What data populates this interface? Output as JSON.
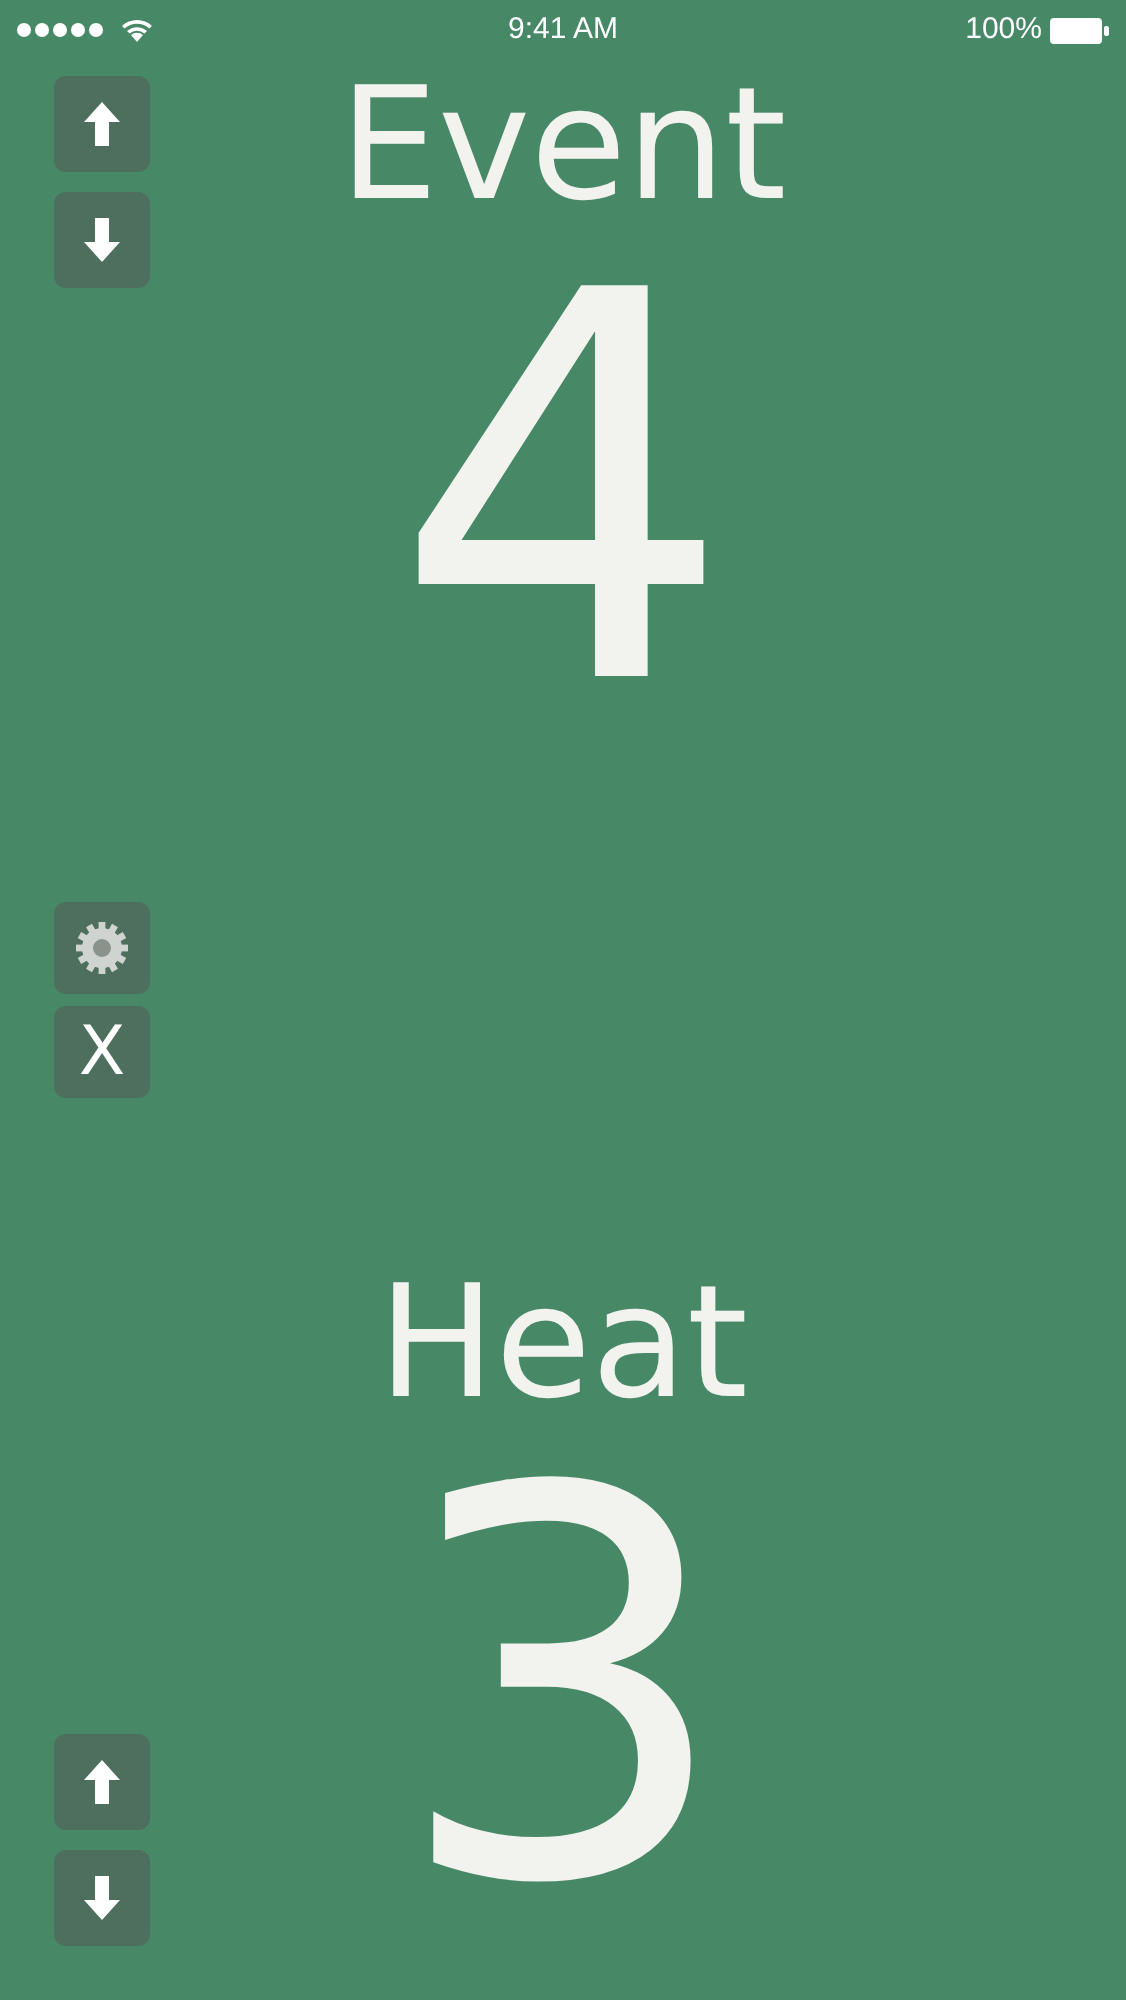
{
  "status_bar": {
    "time": "9:41 AM",
    "battery": "100%"
  },
  "counters": [
    {
      "label": "Event",
      "value": "4"
    },
    {
      "label": "Heat",
      "value": "3"
    }
  ],
  "close_button": {
    "label": "X"
  }
}
